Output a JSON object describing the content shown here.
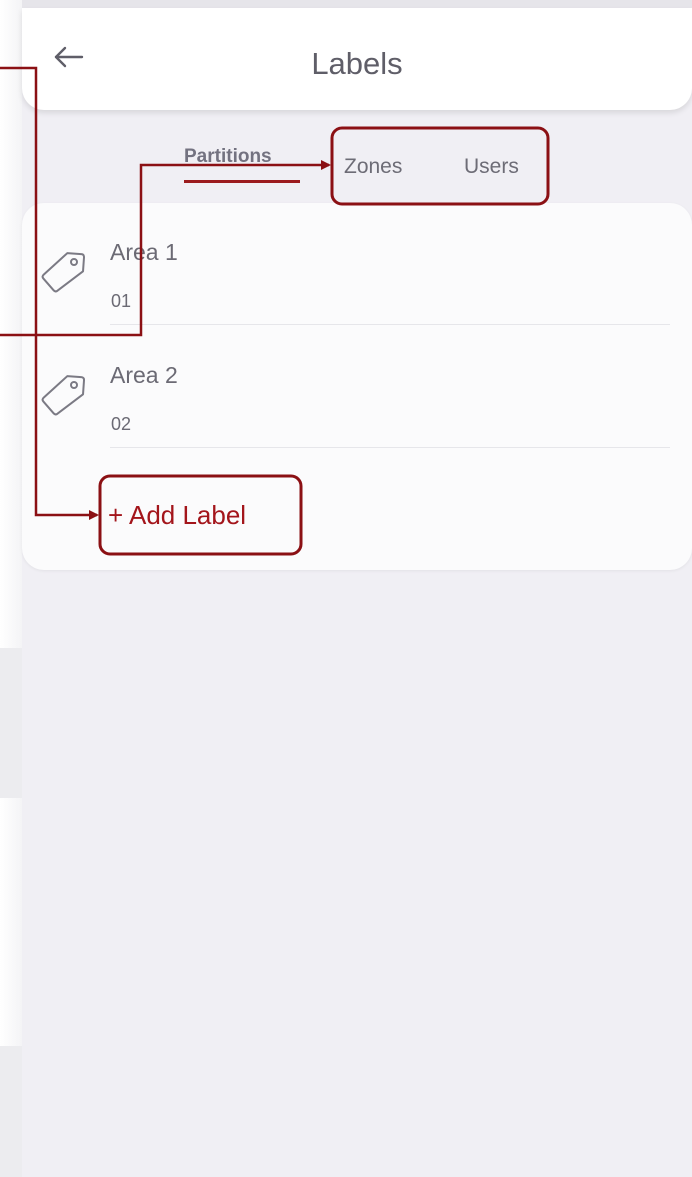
{
  "header": {
    "title": "Labels",
    "back_icon": "arrow-left-icon"
  },
  "tabs": [
    {
      "label": "Partitions",
      "active": true
    },
    {
      "label": "Zones",
      "active": false
    },
    {
      "label": "Users",
      "active": false
    }
  ],
  "labels": [
    {
      "name": "Area 1",
      "code": "01",
      "icon": "tag-icon"
    },
    {
      "name": "Area 2",
      "code": "02",
      "icon": "tag-icon"
    }
  ],
  "add_label": "+ Add Label",
  "colors": {
    "accent": "#9b1b1e",
    "background": "#f0eff4",
    "card": "#fbfbfc",
    "text": "#6b6a74"
  }
}
